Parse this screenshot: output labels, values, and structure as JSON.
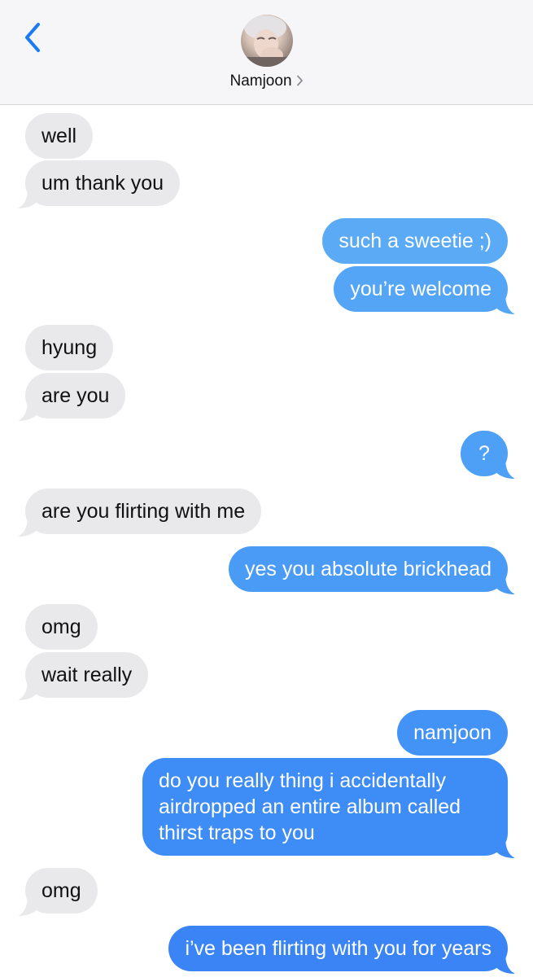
{
  "header": {
    "contact_name": "Namjoon",
    "back_icon": "chevron-left-icon",
    "detail_icon": "chevron-right-icon"
  },
  "colors": {
    "received_bubble": "#e9e9eb",
    "sent_bubble_top": "#58a8f6",
    "sent_bubble_bottom": "#3a82f6",
    "accent": "#1b7af5"
  },
  "messages": [
    {
      "from": "them",
      "text": "well"
    },
    {
      "from": "them",
      "text": "um thank you"
    },
    {
      "from": "me",
      "text": "such a sweetie ;)"
    },
    {
      "from": "me",
      "text": "you’re welcome"
    },
    {
      "from": "them",
      "text": "hyung"
    },
    {
      "from": "them",
      "text": "are you"
    },
    {
      "from": "me",
      "text": "?"
    },
    {
      "from": "them",
      "text": "are you flirting with me"
    },
    {
      "from": "me",
      "text": "yes you absolute brickhead"
    },
    {
      "from": "them",
      "text": "omg"
    },
    {
      "from": "them",
      "text": "wait really"
    },
    {
      "from": "me",
      "text": "namjoon"
    },
    {
      "from": "me",
      "text": "do you really thing i accidentally airdropped an entire album called thirst traps to you"
    },
    {
      "from": "them",
      "text": "omg"
    },
    {
      "from": "me",
      "text": "i’ve been flirting with you for years"
    }
  ]
}
